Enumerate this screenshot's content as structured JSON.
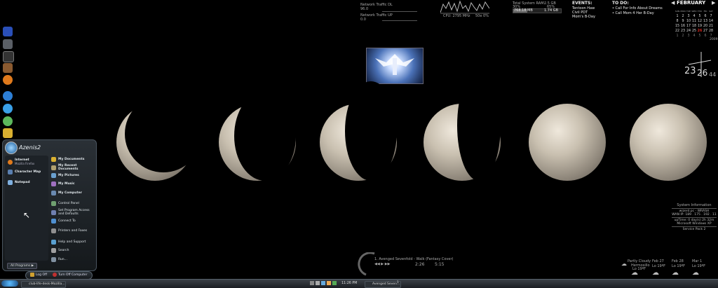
{
  "network": {
    "dl_label": "Network Traffic DL",
    "dl_value": "96.0",
    "ul_label": "Network Traffic UP",
    "ul_value": "0.0"
  },
  "cpu": {
    "cpu_label": "CPU: 2795 MHz",
    "usage": "50e 0%"
  },
  "ram": {
    "total_label": "Total System RAM:",
    "total_value": "2.5 GB",
    "pct1": "30%",
    "pct2": "65%",
    "row_left": "768.18 MB",
    "row_right": "1.74 GB"
  },
  "events": {
    "title": "EVENTS:",
    "items": [
      "Tentoon Haw",
      "Civil PDT",
      "Mom's B-Day"
    ]
  },
  "todo": {
    "title": "TO DO:",
    "items": [
      "Call For Info About Dreams",
      "Call Mom 4 Her B-Day"
    ]
  },
  "calendar": {
    "month": "FEBRUARY",
    "year": "2009",
    "headers": [
      "SUN",
      "MON",
      "TUE",
      "WED",
      "THU",
      "FRI",
      "SAT"
    ],
    "days": [
      "1",
      "2",
      "3",
      "4",
      "5",
      "6",
      "7",
      "8",
      "9",
      "10",
      "11",
      "12",
      "13",
      "14",
      "15",
      "16",
      "17",
      "18",
      "19",
      "20",
      "21",
      "22",
      "23",
      "24",
      "25",
      "26",
      "27",
      "28",
      "1",
      "2",
      "3",
      "4",
      "5",
      "6",
      "7"
    ],
    "today": "26"
  },
  "clock": {
    "hour": "23",
    "minute": "26",
    "second": "44"
  },
  "sysinfo": {
    "title": "System Information",
    "line1": "wizerd.pc - WRASH",
    "line2": "WAN IP: 189 . 175 . 192 . 11",
    "line3": "upTime: 0 day(s) 2h 32m",
    "line4": "Microsoft Windows XP",
    "line5": "Service Pack 2"
  },
  "weather": {
    "current": "Partly Cloudy",
    "place": "Hermosillo",
    "days": [
      {
        "label": "Feb 27",
        "temp": "Lo 19ºF"
      },
      {
        "label": "Feb 28",
        "temp": "Lo 19ºF"
      },
      {
        "label": "Mar 1",
        "temp": "Lo 19ºF"
      }
    ],
    "extra_temp": "Lo 19ºF"
  },
  "music": {
    "track": "1. Avenged Sevenfold - Walk (Fantasy Cover)",
    "elapsed": "2:26",
    "total": "5:15"
  },
  "startmenu": {
    "user": "Azenis2",
    "pinned": [
      {
        "title": "Internet",
        "sub": "Mozilla Firefox",
        "color": "#e07a1c"
      },
      {
        "title": "Character Map",
        "sub": "",
        "color": "#5a7fb0"
      },
      {
        "title": "Notepad",
        "sub": "",
        "color": "#7fb0e0"
      }
    ],
    "places": [
      "My Documents",
      "My Recent Documents",
      "My Pictures",
      "My Music",
      "My Computer",
      "Control Panel",
      "Set Program Access and Defaults",
      "Connect To",
      "Printers and Faxes",
      "Help and Support",
      "Search",
      "Run..."
    ],
    "all_programs": "All Programs",
    "logoff": "Log Off",
    "turnoff": "Turn Off Computer"
  },
  "taskbar": {
    "btn1": "club-life-desk-Mozilla...",
    "time": "11:26 PM",
    "btn2": "Avenged Seven...",
    "btn3": "1"
  }
}
